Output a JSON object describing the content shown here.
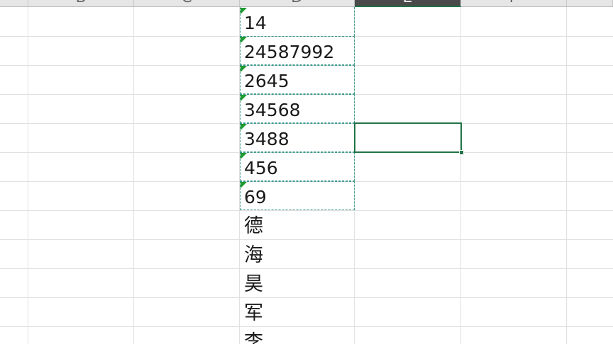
{
  "columns": [
    {
      "key": "A",
      "label": "",
      "active": false
    },
    {
      "key": "B",
      "label": "B",
      "active": false
    },
    {
      "key": "C",
      "label": "C",
      "active": false
    },
    {
      "key": "D",
      "label": "D",
      "active": false
    },
    {
      "key": "E",
      "label": "E",
      "active": true
    },
    {
      "key": "F",
      "label": "F",
      "active": false
    },
    {
      "key": "G",
      "label": "",
      "active": false
    }
  ],
  "column_d_values": [
    "14",
    "24587992",
    "2645",
    "34568",
    "3488",
    "456",
    "69",
    "德",
    "海",
    "昊",
    "军",
    "李"
  ],
  "text_number_indicator_color": "#1e9a2e",
  "selection_color": "#217346"
}
